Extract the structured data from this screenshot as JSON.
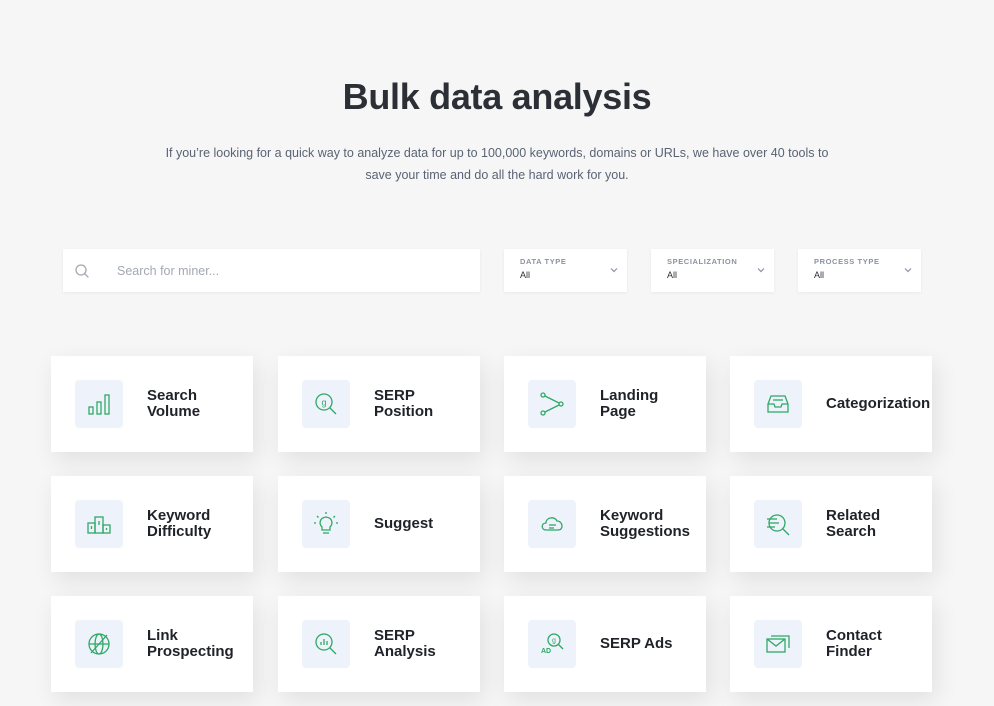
{
  "header": {
    "title": "Bulk data analysis",
    "subtitle": "If you’re looking for a quick way to analyze data for up to 100,000 keywords, domains or URLs, we have over 40 tools to save your time and do all the hard work for you."
  },
  "search": {
    "placeholder": "Search for miner..."
  },
  "filters": [
    {
      "label": "DATA TYPE",
      "value": "All"
    },
    {
      "label": "SPECIALIZATION",
      "value": "All"
    },
    {
      "label": "PROCESS TYPE",
      "value": "All"
    }
  ],
  "tools": [
    {
      "label": "Search\nVolume",
      "icon": "bar-chart-icon"
    },
    {
      "label": "SERP\nPosition",
      "icon": "google-search-icon"
    },
    {
      "label": "Landing\nPage",
      "icon": "share-icon"
    },
    {
      "label": "Categorization",
      "icon": "inbox-tray-icon"
    },
    {
      "label": "Keyword\nDifficulty",
      "icon": "podium-icon"
    },
    {
      "label": "Suggest",
      "icon": "lightbulb-icon"
    },
    {
      "label": "Keyword\nSuggestions",
      "icon": "cloud-text-icon"
    },
    {
      "label": "Related\nSearch",
      "icon": "text-search-icon"
    },
    {
      "label": "Link\nProspecting",
      "icon": "globe-link-icon"
    },
    {
      "label": "SERP\nAnalysis",
      "icon": "chart-search-icon"
    },
    {
      "label": "SERP Ads",
      "icon": "ad-search-icon"
    },
    {
      "label": "Contact\nFinder",
      "icon": "mail-icon"
    }
  ],
  "colors": {
    "accent": "#2fa866",
    "icon_bg": "#eef3fb",
    "background": "#f6f6f6"
  }
}
